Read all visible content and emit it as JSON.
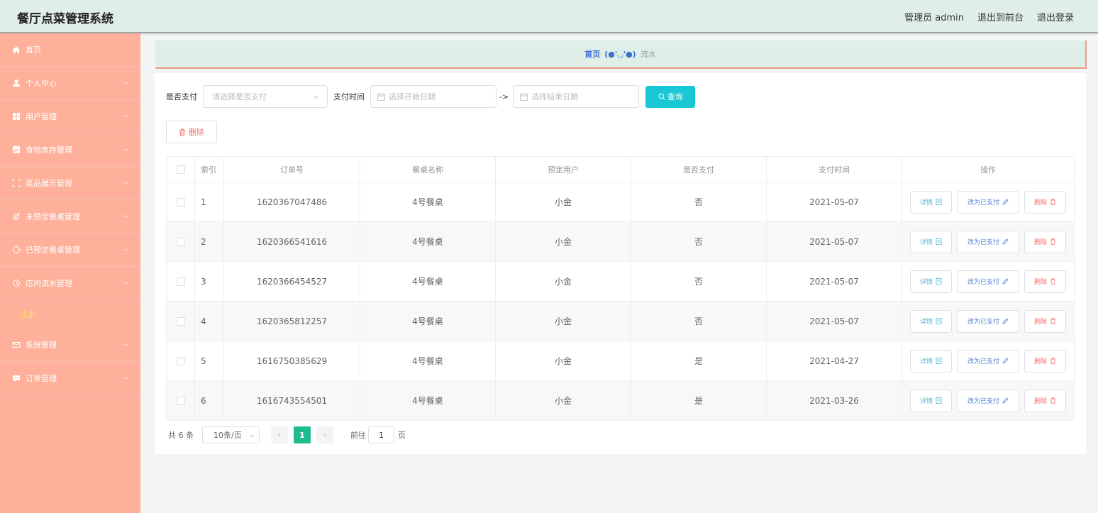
{
  "app": {
    "title": "餐厅点菜管理系统",
    "admin_label": "管理员 admin",
    "back_front": "退出到前台",
    "logout": "退出登录"
  },
  "sidebar": {
    "items": [
      {
        "label": "首页",
        "icon": "home-icon"
      },
      {
        "label": "个人中心",
        "icon": "user-icon"
      },
      {
        "label": "用户管理",
        "icon": "grid-icon"
      },
      {
        "label": "食物库存管理",
        "icon": "chart-icon"
      },
      {
        "label": "菜品展示管理",
        "icon": "frame-icon"
      },
      {
        "label": "未预定餐桌管理",
        "icon": "bell-off-icon"
      },
      {
        "label": "已预定餐桌管理",
        "icon": "target-icon"
      },
      {
        "label": "店内流水管理",
        "icon": "clock-icon"
      },
      {
        "label": "系统管理",
        "icon": "mail-icon"
      },
      {
        "label": "订单管理",
        "icon": "chat-icon"
      }
    ],
    "sub_item": "流水"
  },
  "breadcrumb": {
    "home": "首页",
    "face": "(●'◡'●)",
    "current": "流水"
  },
  "filters": {
    "paid_label": "是否支付",
    "paid_placeholder": "请选择是否支付",
    "time_label": "支付时间",
    "start_placeholder": "选择开始日期",
    "arrow": "->",
    "end_placeholder": "选择结束日期",
    "query_label": "查询"
  },
  "toolbar": {
    "delete_label": "删除"
  },
  "table": {
    "headers": {
      "index": "索引",
      "order_no": "订单号",
      "table_name": "餐桌名称",
      "user": "预定用户",
      "paid": "是否支付",
      "pay_time": "支付时间",
      "ops": "操作"
    },
    "rows": [
      {
        "index": "1",
        "order_no": "1620367047486",
        "table_name": "4号餐桌",
        "user": "小金",
        "paid": "否",
        "pay_time": "2021-05-07"
      },
      {
        "index": "2",
        "order_no": "1620366541616",
        "table_name": "4号餐桌",
        "user": "小金",
        "paid": "否",
        "pay_time": "2021-05-07"
      },
      {
        "index": "3",
        "order_no": "1620366454527",
        "table_name": "4号餐桌",
        "user": "小金",
        "paid": "否",
        "pay_time": "2021-05-07"
      },
      {
        "index": "4",
        "order_no": "1620365812257",
        "table_name": "4号餐桌",
        "user": "小金",
        "paid": "否",
        "pay_time": "2021-05-07"
      },
      {
        "index": "5",
        "order_no": "1616750385629",
        "table_name": "4号餐桌",
        "user": "小金",
        "paid": "是",
        "pay_time": "2021-04-27"
      },
      {
        "index": "6",
        "order_no": "1616743554501",
        "table_name": "4号餐桌",
        "user": "小金",
        "paid": "是",
        "pay_time": "2021-03-26"
      }
    ],
    "actions": {
      "detail": "详情",
      "mark_paid": "改为已支付",
      "delete": "删除"
    }
  },
  "pagination": {
    "total": "共 6 条",
    "page_size": "10条/页",
    "current_page": "1",
    "goto_label": "前往",
    "goto_value": "1",
    "page_suffix": "页"
  },
  "colors": {
    "header_bg": "#dfeee6",
    "sidebar_bg": "#feb09b",
    "sidebar_sub_text": "#f9e55f",
    "query_button": "#19c7d6",
    "active_page": "#1ebc8e",
    "danger": "#f56c6c"
  }
}
